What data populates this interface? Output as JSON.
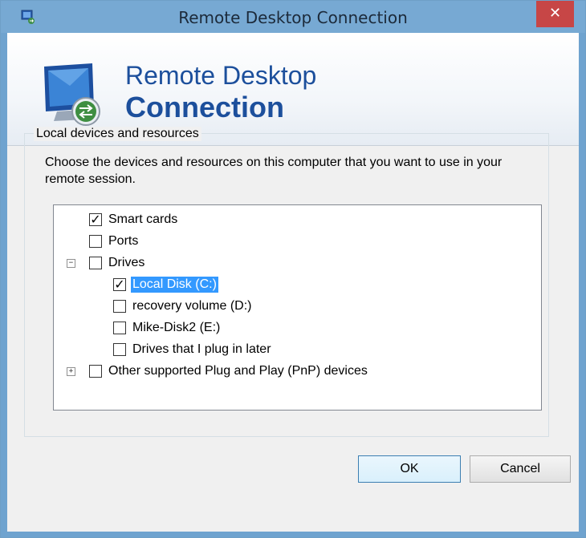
{
  "window": {
    "title": "Remote Desktop Connection",
    "close_glyph": "✕"
  },
  "banner": {
    "line1": "Remote Desktop",
    "line2": "Connection",
    "icon": "remote-desktop-monitor-icon"
  },
  "group": {
    "label": "Local devices and resources",
    "description": "Choose the devices and resources on this computer that you want to use in your remote session."
  },
  "tree": {
    "items": [
      {
        "label": "Smart cards",
        "checked": true
      },
      {
        "label": "Ports",
        "checked": false
      },
      {
        "label": "Drives",
        "checked": false,
        "expander": "⊟",
        "expanded": true
      },
      {
        "label": "Local Disk (C:)",
        "checked": true,
        "selected": true
      },
      {
        "label": "recovery volume (D:)",
        "checked": false
      },
      {
        "label": "Mike-Disk2 (E:)",
        "checked": false
      },
      {
        "label": "Drives that I plug in later",
        "checked": false
      },
      {
        "label": "Other supported Plug and Play (PnP) devices",
        "checked": false,
        "expander": "⊞",
        "expanded": false
      }
    ]
  },
  "buttons": {
    "ok": "OK",
    "cancel": "Cancel"
  },
  "colors": {
    "titlebar": "#77a9d3",
    "close": "#c74646",
    "selection": "#3399ff",
    "banner_text": "#1c4f9c"
  }
}
